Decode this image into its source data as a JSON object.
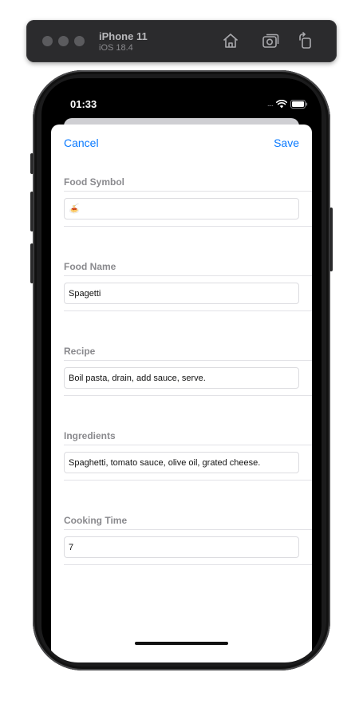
{
  "simulator": {
    "device_name": "iPhone 11",
    "os_version": "iOS 18.4",
    "icons": [
      "home-icon",
      "screenshot-icon",
      "rotate-icon"
    ]
  },
  "status_bar": {
    "time": "01:33",
    "signal": "....",
    "icons": [
      "wifi-icon",
      "battery-icon"
    ]
  },
  "nav": {
    "cancel_label": "Cancel",
    "save_label": "Save",
    "accent_color": "#0a7aff"
  },
  "form": {
    "sections": [
      {
        "header": "Food Symbol",
        "value": "🍝"
      },
      {
        "header": "Food Name",
        "value": "Spagetti"
      },
      {
        "header": "Recipe",
        "value": "Boil pasta, drain, add sauce, serve."
      },
      {
        "header": "Ingredients",
        "value": "Spaghetti, tomato sauce, olive oil, grated cheese."
      },
      {
        "header": "Cooking Time",
        "value": "7"
      }
    ]
  }
}
